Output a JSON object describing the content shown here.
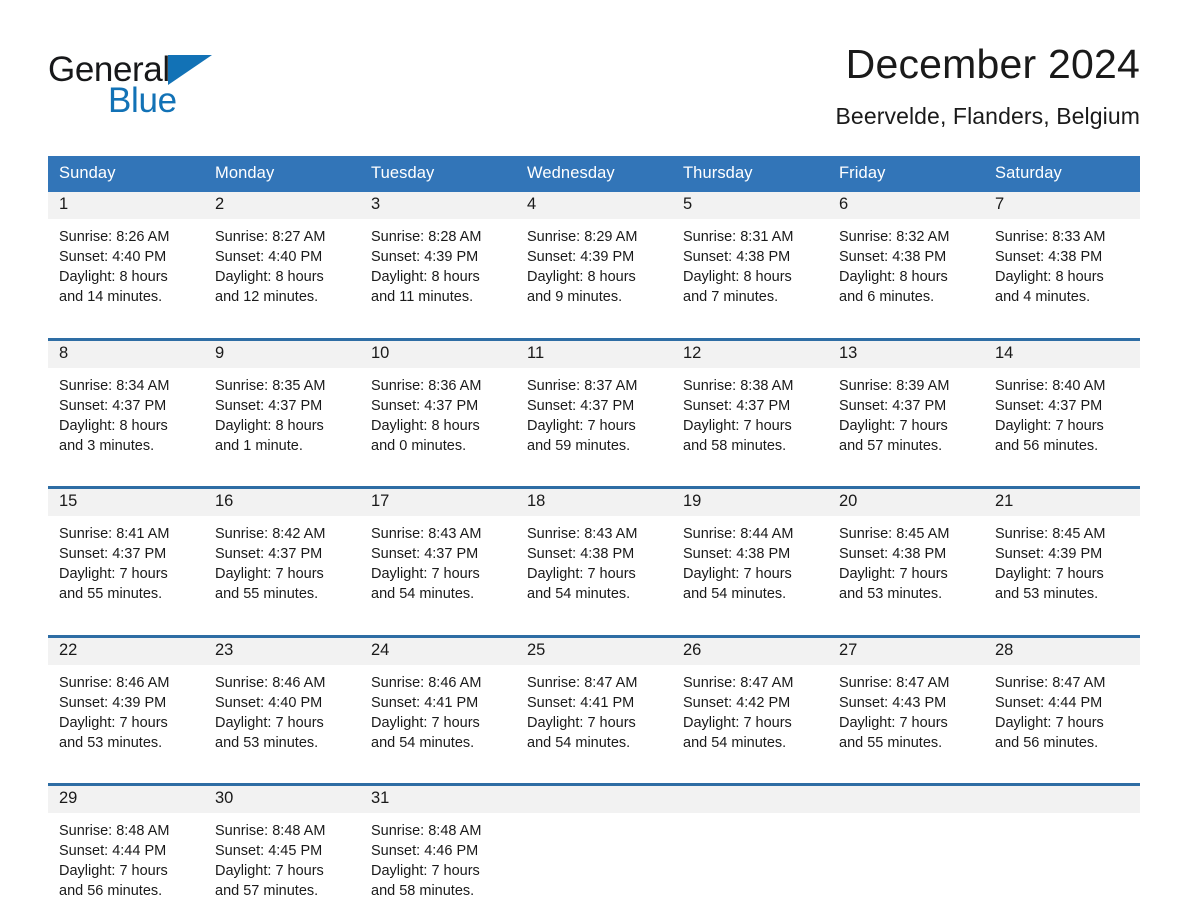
{
  "brand": {
    "name_part1": "General",
    "name_part2": "Blue",
    "logo_icon": "triangle-icon",
    "color_blue": "#1272b6"
  },
  "header": {
    "month_title": "December 2024",
    "location": "Beervelde, Flanders, Belgium"
  },
  "theme": {
    "header_blue": "#3275b8",
    "rule_blue": "#2e6da4",
    "daynum_band": "#f2f2f2",
    "text": "#1a1a1a"
  },
  "calendar": {
    "weekday_headers": [
      "Sunday",
      "Monday",
      "Tuesday",
      "Wednesday",
      "Thursday",
      "Friday",
      "Saturday"
    ],
    "weeks": [
      [
        {
          "day": "1",
          "sunrise": "Sunrise: 8:26 AM",
          "sunset": "Sunset: 4:40 PM",
          "daylight_line1": "Daylight: 8 hours",
          "daylight_line2": "and 14 minutes."
        },
        {
          "day": "2",
          "sunrise": "Sunrise: 8:27 AM",
          "sunset": "Sunset: 4:40 PM",
          "daylight_line1": "Daylight: 8 hours",
          "daylight_line2": "and 12 minutes."
        },
        {
          "day": "3",
          "sunrise": "Sunrise: 8:28 AM",
          "sunset": "Sunset: 4:39 PM",
          "daylight_line1": "Daylight: 8 hours",
          "daylight_line2": "and 11 minutes."
        },
        {
          "day": "4",
          "sunrise": "Sunrise: 8:29 AM",
          "sunset": "Sunset: 4:39 PM",
          "daylight_line1": "Daylight: 8 hours",
          "daylight_line2": "and 9 minutes."
        },
        {
          "day": "5",
          "sunrise": "Sunrise: 8:31 AM",
          "sunset": "Sunset: 4:38 PM",
          "daylight_line1": "Daylight: 8 hours",
          "daylight_line2": "and 7 minutes."
        },
        {
          "day": "6",
          "sunrise": "Sunrise: 8:32 AM",
          "sunset": "Sunset: 4:38 PM",
          "daylight_line1": "Daylight: 8 hours",
          "daylight_line2": "and 6 minutes."
        },
        {
          "day": "7",
          "sunrise": "Sunrise: 8:33 AM",
          "sunset": "Sunset: 4:38 PM",
          "daylight_line1": "Daylight: 8 hours",
          "daylight_line2": "and 4 minutes."
        }
      ],
      [
        {
          "day": "8",
          "sunrise": "Sunrise: 8:34 AM",
          "sunset": "Sunset: 4:37 PM",
          "daylight_line1": "Daylight: 8 hours",
          "daylight_line2": "and 3 minutes."
        },
        {
          "day": "9",
          "sunrise": "Sunrise: 8:35 AM",
          "sunset": "Sunset: 4:37 PM",
          "daylight_line1": "Daylight: 8 hours",
          "daylight_line2": "and 1 minute."
        },
        {
          "day": "10",
          "sunrise": "Sunrise: 8:36 AM",
          "sunset": "Sunset: 4:37 PM",
          "daylight_line1": "Daylight: 8 hours",
          "daylight_line2": "and 0 minutes."
        },
        {
          "day": "11",
          "sunrise": "Sunrise: 8:37 AM",
          "sunset": "Sunset: 4:37 PM",
          "daylight_line1": "Daylight: 7 hours",
          "daylight_line2": "and 59 minutes."
        },
        {
          "day": "12",
          "sunrise": "Sunrise: 8:38 AM",
          "sunset": "Sunset: 4:37 PM",
          "daylight_line1": "Daylight: 7 hours",
          "daylight_line2": "and 58 minutes."
        },
        {
          "day": "13",
          "sunrise": "Sunrise: 8:39 AM",
          "sunset": "Sunset: 4:37 PM",
          "daylight_line1": "Daylight: 7 hours",
          "daylight_line2": "and 57 minutes."
        },
        {
          "day": "14",
          "sunrise": "Sunrise: 8:40 AM",
          "sunset": "Sunset: 4:37 PM",
          "daylight_line1": "Daylight: 7 hours",
          "daylight_line2": "and 56 minutes."
        }
      ],
      [
        {
          "day": "15",
          "sunrise": "Sunrise: 8:41 AM",
          "sunset": "Sunset: 4:37 PM",
          "daylight_line1": "Daylight: 7 hours",
          "daylight_line2": "and 55 minutes."
        },
        {
          "day": "16",
          "sunrise": "Sunrise: 8:42 AM",
          "sunset": "Sunset: 4:37 PM",
          "daylight_line1": "Daylight: 7 hours",
          "daylight_line2": "and 55 minutes."
        },
        {
          "day": "17",
          "sunrise": "Sunrise: 8:43 AM",
          "sunset": "Sunset: 4:37 PM",
          "daylight_line1": "Daylight: 7 hours",
          "daylight_line2": "and 54 minutes."
        },
        {
          "day": "18",
          "sunrise": "Sunrise: 8:43 AM",
          "sunset": "Sunset: 4:38 PM",
          "daylight_line1": "Daylight: 7 hours",
          "daylight_line2": "and 54 minutes."
        },
        {
          "day": "19",
          "sunrise": "Sunrise: 8:44 AM",
          "sunset": "Sunset: 4:38 PM",
          "daylight_line1": "Daylight: 7 hours",
          "daylight_line2": "and 54 minutes."
        },
        {
          "day": "20",
          "sunrise": "Sunrise: 8:45 AM",
          "sunset": "Sunset: 4:38 PM",
          "daylight_line1": "Daylight: 7 hours",
          "daylight_line2": "and 53 minutes."
        },
        {
          "day": "21",
          "sunrise": "Sunrise: 8:45 AM",
          "sunset": "Sunset: 4:39 PM",
          "daylight_line1": "Daylight: 7 hours",
          "daylight_line2": "and 53 minutes."
        }
      ],
      [
        {
          "day": "22",
          "sunrise": "Sunrise: 8:46 AM",
          "sunset": "Sunset: 4:39 PM",
          "daylight_line1": "Daylight: 7 hours",
          "daylight_line2": "and 53 minutes."
        },
        {
          "day": "23",
          "sunrise": "Sunrise: 8:46 AM",
          "sunset": "Sunset: 4:40 PM",
          "daylight_line1": "Daylight: 7 hours",
          "daylight_line2": "and 53 minutes."
        },
        {
          "day": "24",
          "sunrise": "Sunrise: 8:46 AM",
          "sunset": "Sunset: 4:41 PM",
          "daylight_line1": "Daylight: 7 hours",
          "daylight_line2": "and 54 minutes."
        },
        {
          "day": "25",
          "sunrise": "Sunrise: 8:47 AM",
          "sunset": "Sunset: 4:41 PM",
          "daylight_line1": "Daylight: 7 hours",
          "daylight_line2": "and 54 minutes."
        },
        {
          "day": "26",
          "sunrise": "Sunrise: 8:47 AM",
          "sunset": "Sunset: 4:42 PM",
          "daylight_line1": "Daylight: 7 hours",
          "daylight_line2": "and 54 minutes."
        },
        {
          "day": "27",
          "sunrise": "Sunrise: 8:47 AM",
          "sunset": "Sunset: 4:43 PM",
          "daylight_line1": "Daylight: 7 hours",
          "daylight_line2": "and 55 minutes."
        },
        {
          "day": "28",
          "sunrise": "Sunrise: 8:47 AM",
          "sunset": "Sunset: 4:44 PM",
          "daylight_line1": "Daylight: 7 hours",
          "daylight_line2": "and 56 minutes."
        }
      ],
      [
        {
          "day": "29",
          "sunrise": "Sunrise: 8:48 AM",
          "sunset": "Sunset: 4:44 PM",
          "daylight_line1": "Daylight: 7 hours",
          "daylight_line2": "and 56 minutes."
        },
        {
          "day": "30",
          "sunrise": "Sunrise: 8:48 AM",
          "sunset": "Sunset: 4:45 PM",
          "daylight_line1": "Daylight: 7 hours",
          "daylight_line2": "and 57 minutes."
        },
        {
          "day": "31",
          "sunrise": "Sunrise: 8:48 AM",
          "sunset": "Sunset: 4:46 PM",
          "daylight_line1": "Daylight: 7 hours",
          "daylight_line2": "and 58 minutes."
        },
        {
          "day": "",
          "sunrise": "",
          "sunset": "",
          "daylight_line1": "",
          "daylight_line2": ""
        },
        {
          "day": "",
          "sunrise": "",
          "sunset": "",
          "daylight_line1": "",
          "daylight_line2": ""
        },
        {
          "day": "",
          "sunrise": "",
          "sunset": "",
          "daylight_line1": "",
          "daylight_line2": ""
        },
        {
          "day": "",
          "sunrise": "",
          "sunset": "",
          "daylight_line1": "",
          "daylight_line2": ""
        }
      ]
    ]
  }
}
